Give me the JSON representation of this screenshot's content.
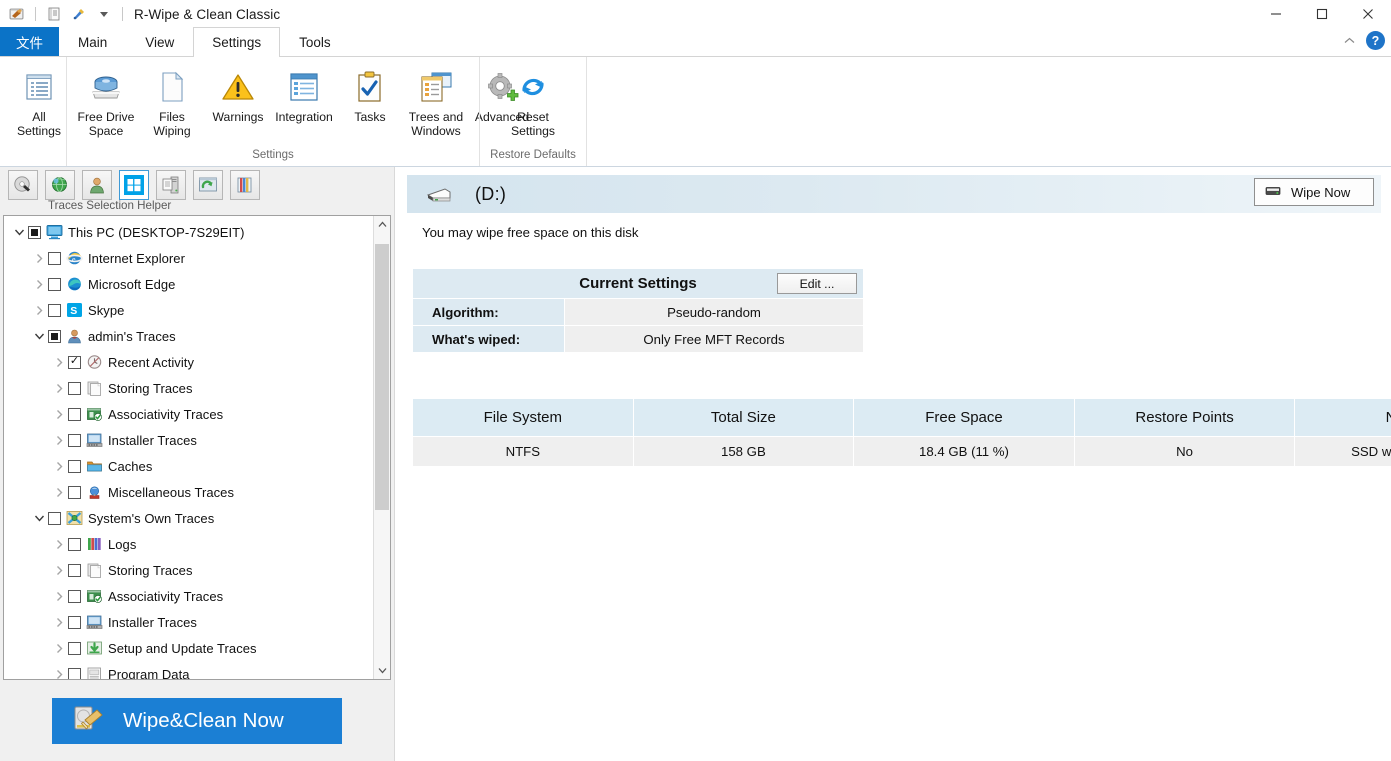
{
  "window": {
    "title": "R-Wipe & Clean Classic",
    "quick_access": [
      "app-icon",
      "journal-icon",
      "tools-icon",
      "dropdown-caret"
    ],
    "controls": {
      "minimize": "minimize-icon",
      "maximize": "maximize-icon",
      "close": "close-icon"
    }
  },
  "tabs": {
    "file_label": "文件",
    "items": [
      {
        "label": "Main",
        "active": false
      },
      {
        "label": "View",
        "active": false
      },
      {
        "label": "Settings",
        "active": true
      },
      {
        "label": "Tools",
        "active": false
      }
    ],
    "collapse_ribbon": "chevron-up-icon",
    "help": "?"
  },
  "ribbon": {
    "groups": [
      {
        "name": "",
        "label": "",
        "buttons": [
          {
            "label": "All\nSettings",
            "line1": "All",
            "line2": "Settings",
            "icon": "all-settings-icon"
          }
        ]
      },
      {
        "name": "settings",
        "label": "Settings",
        "buttons": [
          {
            "line1": "Free Drive",
            "line2": "Space",
            "icon": "free-drive-space-icon"
          },
          {
            "line1": "Files",
            "line2": "Wiping",
            "icon": "files-wiping-icon"
          },
          {
            "line1": "Warnings",
            "line2": "",
            "icon": "warnings-icon"
          },
          {
            "line1": "Integration",
            "line2": "",
            "icon": "integration-icon"
          },
          {
            "line1": "Tasks",
            "line2": "",
            "icon": "tasks-icon"
          },
          {
            "line1": "Trees and",
            "line2": "Windows",
            "icon": "trees-and-windows-icon"
          },
          {
            "line1": "Advanced",
            "line2": "",
            "icon": "advanced-icon"
          }
        ]
      },
      {
        "name": "restore-defaults",
        "label": "Restore Defaults",
        "buttons": [
          {
            "line1": "Reset",
            "line2": "Settings",
            "icon": "reset-settings-icon"
          }
        ]
      }
    ]
  },
  "left_panel": {
    "toolbar_label": "Traces Selection Helper",
    "tools": [
      {
        "name": "disk-wipe-icon",
        "selected": false
      },
      {
        "name": "internet-traces-icon",
        "selected": false
      },
      {
        "name": "user-traces-icon",
        "selected": false
      },
      {
        "name": "windows-traces-icon",
        "selected": true
      },
      {
        "name": "system-traces-icon",
        "selected": false
      },
      {
        "name": "refresh-traces-icon",
        "selected": false
      },
      {
        "name": "applications-traces-icon",
        "selected": false
      }
    ],
    "tree": [
      {
        "label": "This PC  (DESKTOP-7S29EIT)",
        "indent": 0,
        "expander": "down",
        "check": "partial",
        "icon": "this-pc-icon"
      },
      {
        "label": "Internet  Explorer",
        "indent": 1,
        "expander": "right",
        "check": "none",
        "icon": "internet-explorer-icon"
      },
      {
        "label": "Microsoft Edge",
        "indent": 1,
        "expander": "right",
        "check": "none",
        "icon": "microsoft-edge-icon"
      },
      {
        "label": "Skype",
        "indent": 1,
        "expander": "right",
        "check": "none",
        "icon": "skype-icon"
      },
      {
        "label": "admin's Traces",
        "indent": 1,
        "expander": "down",
        "check": "partial",
        "icon": "user-icon"
      },
      {
        "label": "Recent Activity",
        "indent": 2,
        "expander": "right",
        "check": "checked",
        "icon": "recent-activity-icon"
      },
      {
        "label": "Storing Traces",
        "indent": 2,
        "expander": "right",
        "check": "none",
        "icon": "storing-traces-icon"
      },
      {
        "label": "Associativity Traces",
        "indent": 2,
        "expander": "right",
        "check": "none",
        "icon": "associativity-traces-icon"
      },
      {
        "label": "Installer Traces",
        "indent": 2,
        "expander": "right",
        "check": "none",
        "icon": "installer-traces-icon"
      },
      {
        "label": "Caches",
        "indent": 2,
        "expander": "right",
        "check": "none",
        "icon": "caches-icon"
      },
      {
        "label": "Miscellaneous Traces",
        "indent": 2,
        "expander": "right",
        "check": "none",
        "icon": "miscellaneous-traces-icon"
      },
      {
        "label": "System's Own Traces",
        "indent": 1,
        "expander": "down",
        "check": "none",
        "icon": "system-own-traces-icon"
      },
      {
        "label": "Logs",
        "indent": 2,
        "expander": "right",
        "check": "none",
        "icon": "logs-icon"
      },
      {
        "label": "Storing Traces",
        "indent": 2,
        "expander": "right",
        "check": "none",
        "icon": "storing-traces-icon"
      },
      {
        "label": "Associativity Traces",
        "indent": 2,
        "expander": "right",
        "check": "none",
        "icon": "associativity-traces-icon"
      },
      {
        "label": "Installer Traces",
        "indent": 2,
        "expander": "right",
        "check": "none",
        "icon": "installer-traces-icon"
      },
      {
        "label": "Setup and Update Traces",
        "indent": 2,
        "expander": "right",
        "check": "none",
        "icon": "setup-update-traces-icon"
      },
      {
        "label": "Program Data",
        "indent": 2,
        "expander": "right",
        "check": "none",
        "icon": "program-data-icon"
      }
    ],
    "wipe_clean_button": "Wipe&Clean Now"
  },
  "main": {
    "disk_name": "(D:)",
    "wipe_now_label": "Wipe Now",
    "note": "You may wipe free space on this disk",
    "current_settings": {
      "title": "Current Settings",
      "edit_label": "Edit ...",
      "rows": [
        {
          "key": "Algorithm:",
          "value": "Pseudo-random"
        },
        {
          "key": "What's wiped:",
          "value": "Only Free MFT Records"
        }
      ]
    },
    "disk_table": {
      "headers": [
        "File System",
        "Total Size",
        "Free Space",
        "Restore Points",
        "Notes"
      ],
      "row": [
        "NTFS",
        "158 GB",
        "18.4 GB  (11 %)",
        "No",
        "SSD with TRIM on"
      ]
    }
  },
  "colors": {
    "accent_blue": "#0b73c7",
    "button_blue": "#1b7fd4",
    "header_blue": "#ddeaf2",
    "row_gray": "#efefef",
    "panel_gray": "#f0f0f0"
  }
}
